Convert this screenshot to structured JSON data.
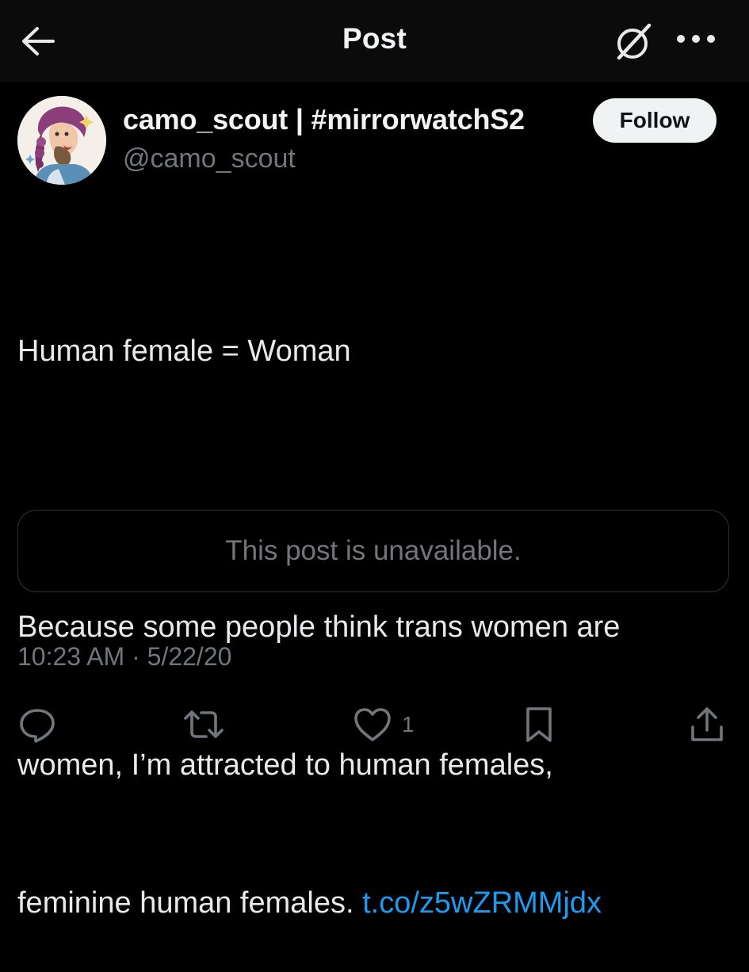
{
  "header": {
    "title": "Post",
    "back_icon": "arrow-left-icon",
    "grok_icon": "grok-icon",
    "more_icon": "more-horizontal-icon"
  },
  "author": {
    "display_name": "camo_scout | #mirrorwatchS2",
    "handle": "@camo_scout",
    "avatar": "avatar-illustration",
    "follow_label": "Follow"
  },
  "tweet": {
    "line1": "Human female = Woman",
    "line2": "Because some people think trans women are",
    "line3": "women, I’m attracted to human females,",
    "line4_prefix": "feminine human females. ",
    "link": "t.co/z5wZRMMjdx"
  },
  "quote": {
    "unavailable_text": "This post is unavailable."
  },
  "meta": {
    "timestamp": "10:23 AM · 5/22/20"
  },
  "actions": {
    "reply_icon": "reply-icon",
    "repost_icon": "repost-icon",
    "like_icon": "heart-icon",
    "like_count": "1",
    "bookmark_icon": "bookmark-icon",
    "share_icon": "share-icon"
  },
  "colors": {
    "background": "#000000",
    "header_bg": "#0b0b0c",
    "text": "#e7e9ea",
    "muted": "#71767b",
    "link": "#1d9bf0",
    "border": "#2f3336",
    "follow_bg": "#eff3f4"
  }
}
